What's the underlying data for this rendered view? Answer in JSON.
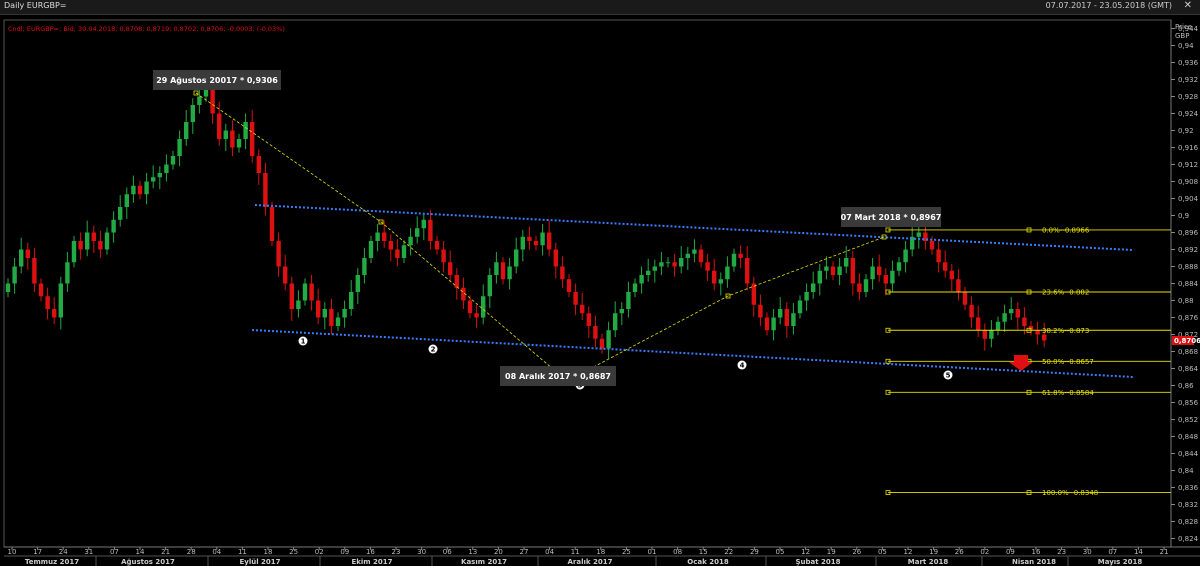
{
  "window": {
    "title": "Daily EURGBP=",
    "range": "07.07.2017 - 23.05.2018 (GMT)",
    "legend": "Cndl; EURGBP=; Bid; 30.04.2018; 0,8708; 0,8719; 0,8702; 0,8706; -0,0003; (-0,03%)"
  },
  "axis": {
    "y_title": "Price",
    "y_unit": "GBP",
    "y_ticks": [
      "0,944",
      "0,94",
      "0,936",
      "0,932",
      "0,928",
      "0,924",
      "0,92",
      "0,916",
      "0,912",
      "0,908",
      "0,904",
      "0,9",
      "0,896",
      "0,892",
      "0,888",
      "0,884",
      "0,88",
      "0,876",
      "0,872",
      "0,868",
      "0,864",
      "0,86",
      "0,856",
      "0,852",
      "0,848",
      "0,844",
      "0,84",
      "0,836",
      "0,832",
      "0,828",
      "0,824"
    ],
    "x_ticks": [
      "10",
      "17",
      "24",
      "31",
      "07",
      "14",
      "21",
      "28",
      "04",
      "11",
      "18",
      "25",
      "02",
      "09",
      "16",
      "23",
      "30",
      "06",
      "13",
      "20",
      "27",
      "04",
      "11",
      "18",
      "25",
      "01",
      "08",
      "15",
      "22",
      "29",
      "05",
      "12",
      "19",
      "26",
      "05",
      "12",
      "19",
      "26",
      "02",
      "09",
      "16",
      "23",
      "30",
      "07",
      "14",
      "21"
    ],
    "months": [
      "Temmuz 2017",
      "Ağustos 2017",
      "Eylül 2017",
      "Ekim 2017",
      "Kasım 2017",
      "Aralık 2017",
      "Ocak 2018",
      "Şubat 2018",
      "Mart 2018",
      "Nisan 2018",
      "Mayıs 2018"
    ],
    "last_price": "0,8706"
  },
  "annotations": [
    {
      "text": "29 Ağustos 20017 * 0,9306"
    },
    {
      "text": "08 Aralık 2017 * 0,8687"
    },
    {
      "text": "07 Mart 2018 * 0,8967"
    }
  ],
  "points": [
    "1",
    "2",
    "3",
    "4",
    "5"
  ],
  "fibonacci": [
    {
      "label": "0.0%--0.8966",
      "price": 0.8966
    },
    {
      "label": "23.6%--0.882",
      "price": 0.882
    },
    {
      "label": "38.2%--0.873",
      "price": 0.873
    },
    {
      "label": "50.0%--0.8657",
      "price": 0.8657
    },
    {
      "label": "61.8%--0.8584",
      "price": 0.8584
    },
    {
      "label": "100.0%--0.8348",
      "price": 0.8348
    }
  ],
  "colors": {
    "up": "#22aa44",
    "down": "#dd1111",
    "channel": "#3a7dff",
    "fib": "#e8e000",
    "last": "#dd1111"
  },
  "chart_data": {
    "type": "candlestick",
    "ylim": [
      0.822,
      0.946
    ],
    "grid": false,
    "series": [
      {
        "name": "EURGBP=",
        "close": [
          0.884,
          0.888,
          0.892,
          0.89,
          0.884,
          0.881,
          0.878,
          0.876,
          0.884,
          0.889,
          0.894,
          0.892,
          0.896,
          0.894,
          0.892,
          0.896,
          0.899,
          0.902,
          0.905,
          0.907,
          0.905,
          0.908,
          0.909,
          0.91,
          0.912,
          0.914,
          0.918,
          0.922,
          0.926,
          0.928,
          0.93,
          0.924,
          0.918,
          0.92,
          0.916,
          0.918,
          0.922,
          0.914,
          0.91,
          0.902,
          0.894,
          0.888,
          0.884,
          0.878,
          0.88,
          0.884,
          0.88,
          0.876,
          0.878,
          0.874,
          0.876,
          0.878,
          0.882,
          0.886,
          0.89,
          0.894,
          0.896,
          0.894,
          0.892,
          0.89,
          0.893,
          0.895,
          0.897,
          0.899,
          0.894,
          0.892,
          0.889,
          0.886,
          0.883,
          0.88,
          0.877,
          0.876,
          0.881,
          0.886,
          0.889,
          0.885,
          0.888,
          0.892,
          0.895,
          0.894,
          0.893,
          0.896,
          0.892,
          0.888,
          0.885,
          0.882,
          0.879,
          0.877,
          0.874,
          0.871,
          0.8687,
          0.873,
          0.877,
          0.878,
          0.882,
          0.884,
          0.886,
          0.887,
          0.888,
          0.889,
          0.889,
          0.888,
          0.89,
          0.891,
          0.892,
          0.889,
          0.887,
          0.884,
          0.885,
          0.888,
          0.891,
          0.89,
          0.884,
          0.879,
          0.876,
          0.873,
          0.876,
          0.878,
          0.874,
          0.877,
          0.88,
          0.882,
          0.884,
          0.887,
          0.888,
          0.886,
          0.888,
          0.89,
          0.884,
          0.882,
          0.885,
          0.888,
          0.886,
          0.884,
          0.887,
          0.889,
          0.892,
          0.895,
          0.896,
          0.894,
          0.892,
          0.889,
          0.887,
          0.885,
          0.882,
          0.879,
          0.876,
          0.873,
          0.871,
          0.873,
          0.875,
          0.877,
          0.878,
          0.876,
          0.874,
          0.873,
          0.872,
          0.8706
        ]
      }
    ]
  }
}
